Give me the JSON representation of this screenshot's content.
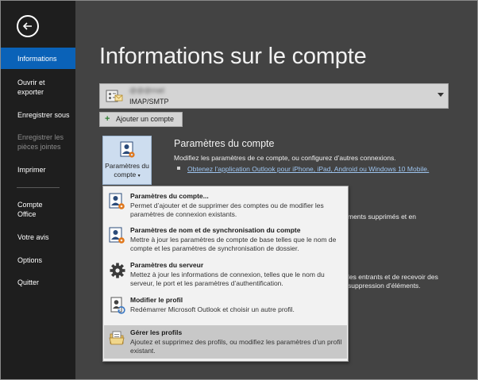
{
  "sidebar": {
    "items": [
      {
        "label": "Informations",
        "state": "active"
      },
      {
        "label": "Ouvrir et exporter",
        "state": "normal"
      },
      {
        "label": "Enregistrer sous",
        "state": "normal"
      },
      {
        "label": "Enregistrer les pièces jointes",
        "state": "disabled"
      },
      {
        "label": "Imprimer",
        "state": "normal"
      },
      {
        "label": "Compte Office",
        "state": "normal"
      },
      {
        "label": "Votre avis",
        "state": "normal"
      },
      {
        "label": "Options",
        "state": "normal"
      },
      {
        "label": "Quitter",
        "state": "normal"
      }
    ]
  },
  "main": {
    "title": "Informations sur le compte",
    "account": {
      "email": "@@@mail",
      "type": "IMAP/SMTP"
    },
    "add_account_label": "Ajouter un compte",
    "settings_button_label": "Paramètres du compte",
    "section": {
      "title": "Paramètres du compte",
      "description": "Modifiez les paramètres de ce compte, ou configurez d’autres connexions.",
      "link": "Obtenez l’application Outlook pour iPhone, iPad, Android ou Windows 10 Mobile."
    },
    "bg_text_1": "ments supprimés et en",
    "bg_text_2a": "les entrants et de recevoir des",
    "bg_text_2b": "suppression d’éléments."
  },
  "menu": {
    "items": [
      {
        "title": "Paramètres du compte...",
        "description": "Permet d’ajouter et de supprimer des comptes ou de modifier les paramètres de connexion existants.",
        "icon": "account-settings-icon"
      },
      {
        "title": "Paramètres de nom et de synchronisation du compte",
        "description": "Mettre à jour les paramètres de compte de base telles que le nom de compte et les paramètres de synchronisation de dossier.",
        "icon": "account-sync-icon"
      },
      {
        "title": "Paramètres du serveur",
        "description": "Mettez à jour les informations de connexion, telles que le nom du serveur, le port et les paramètres d’authentification.",
        "icon": "gear-icon"
      },
      {
        "title": "Modifier le profil",
        "description": "Redémarrer Microsoft Outlook et choisir un autre profil.",
        "icon": "profile-icon"
      },
      {
        "title": "Gérer les profils",
        "description": "Ajoutez et supprimez des profils, ou modifiez les paramètres d’un profil existant.",
        "icon": "manage-profiles-icon"
      }
    ]
  },
  "colors": {
    "accent": "#0a62b8",
    "sidebar_bg": "#1e1e1e",
    "main_bg": "#434343",
    "link": "#9ec5f0"
  }
}
